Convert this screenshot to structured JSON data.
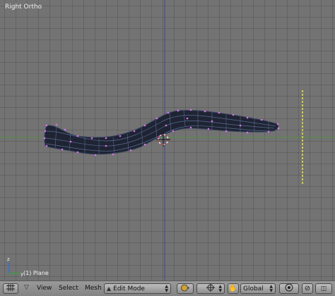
{
  "viewport": {
    "title": "Right Ortho",
    "object_label": "(1) Plane"
  },
  "header": {
    "menus": {
      "view": "View",
      "select": "Select",
      "mesh": "Mesh"
    },
    "mode": {
      "label": "Edit Mode",
      "icon": "triangle-mode-icon"
    },
    "orientation": {
      "label": "Global"
    },
    "icons": [
      "grid-icon",
      "expand-arrow-icon",
      "shading-icon",
      "pivot-icon",
      "hand-manipulator-icon",
      "proportional-edit-icon",
      "snap-icon"
    ]
  },
  "colors": {
    "viewport_bg": "#737373",
    "mesh": "#1e2433",
    "vertex": "#e070f0",
    "y_axis": "#5a8a4a",
    "z_axis": "#4a4a9a",
    "lamp": "#e8e03a"
  }
}
